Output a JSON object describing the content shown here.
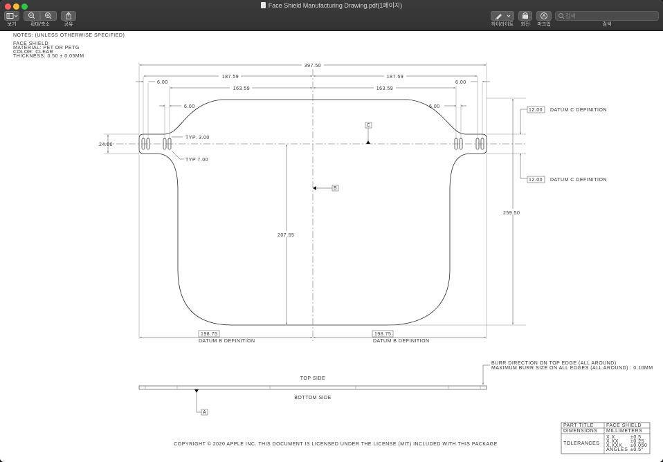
{
  "window": {
    "title": "Face Shield Manufacturing Drawing.pdf(1페이지)",
    "traffic_colors": {
      "close": "#ff5f57",
      "minimize": "#febc2e",
      "zoom": "#28c840"
    }
  },
  "toolbar": {
    "view_label": "보기",
    "zoom_label": "확대/축소",
    "share_label": "공유",
    "highlight_label": "하이라이트",
    "rotate_label": "회전",
    "markup_label": "마크업",
    "search_label": "검색",
    "search_placeholder": "검색"
  },
  "notes": {
    "heading": "NOTES: (UNLESS OTHERWISE SPECIFIED)",
    "lines": [
      "FACE SHIELD",
      "MATERIAL: PET OR PETG",
      "COLOR: CLEAR",
      "THICKNESS: 0.50 ± 0.05MM"
    ]
  },
  "dimensions": {
    "overall_width": "397.50",
    "half_width_left": "187.59",
    "half_width_right": "187.59",
    "inner_left": "163.59",
    "inner_right": "163.59",
    "slot_left": "6.00",
    "slot_right": "6.00",
    "hole_left": "6.00",
    "hole_right": "6.00",
    "tab_height": "24.00",
    "typ_spacing": "TYP. 3.00",
    "typ_offset": "TYP 7.00",
    "center_height": "207.55",
    "overall_height": "259.50",
    "datum_c_top_value": "12.00",
    "datum_c_top_label": "DATUM C DEFINITION",
    "datum_c_bottom_value": "12.00",
    "datum_c_bottom_label": "DATUM C DEFINITION",
    "datum_b_left_value": "198.75",
    "datum_b_left_label": "DATUM B DEFINITION",
    "datum_b_right_value": "198.75",
    "datum_b_right_label": "DATUM B DEFINITION",
    "datum_c_marker": "C",
    "datum_b_marker": "B",
    "datum_a_marker": "A"
  },
  "side_view": {
    "top_label": "TOP SIDE",
    "bottom_label": "BOTTOM SIDE",
    "burr_line1": "BURR DIRECTION ON TOP EDGE (ALL AROUND)",
    "burr_line2": "MAXIMUM BURR SIZE ON ALL EDGES (ALL AROUND) : 0.10MM"
  },
  "title_block": {
    "part_title_label": "PART TITLE",
    "part_title_value": "FACE SHIELD",
    "dimensions_label": "DIMENSIONS",
    "dimensions_value": "MILLIMETERS",
    "tolerances_label": "TOLERANCES",
    "tol_rows": [
      {
        "key": "X.X",
        "val": "±0.5"
      },
      {
        "key": "X.XX",
        "val": "±0.25"
      },
      {
        "key": "X.XXX",
        "val": "±0.050"
      },
      {
        "key": "ANGLES",
        "val": "±0.5°"
      }
    ]
  },
  "copyright": "COPYRIGHT © 2020 APPLE INC. THIS DOCUMENT IS LICENSED UNDER THE LICENSE (MIT) INCLUDED WITH THIS PACKAGE"
}
